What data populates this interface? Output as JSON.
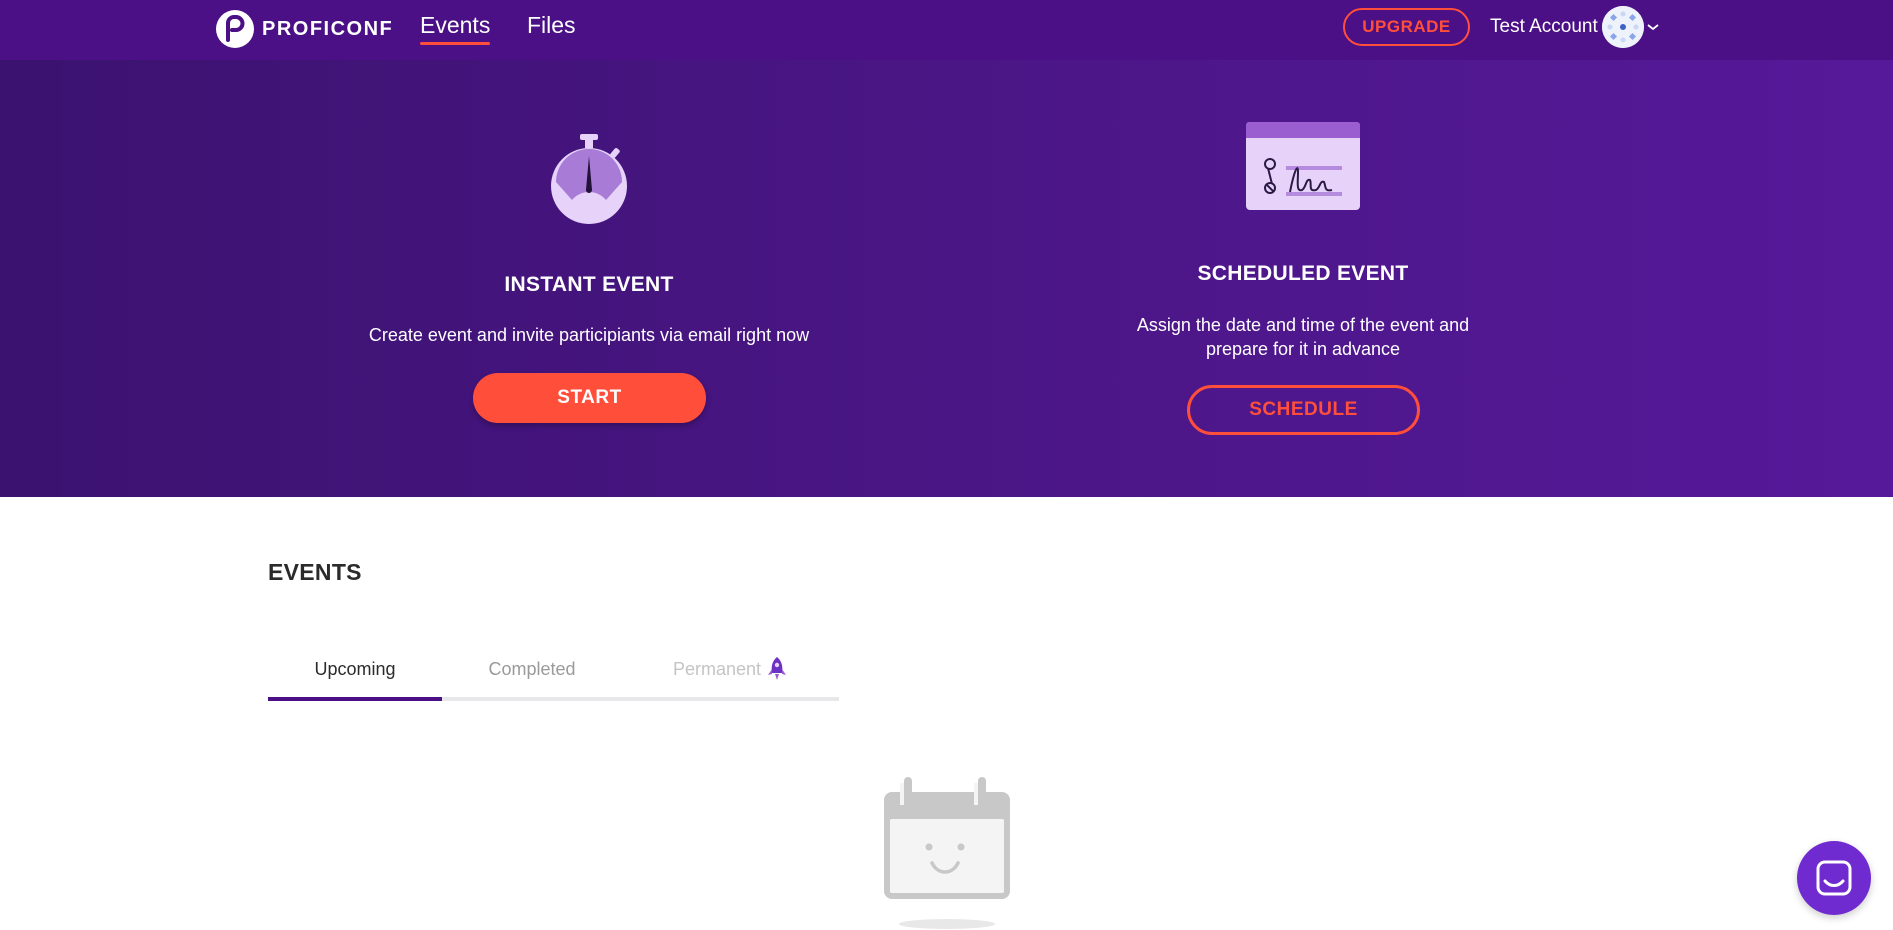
{
  "app": {
    "brand_name": "PROFICONF"
  },
  "nav": {
    "links": [
      {
        "label": "Events",
        "active": true
      },
      {
        "label": "Files",
        "active": false
      }
    ],
    "upgrade_label": "UPGRADE",
    "account_name": "Test Account"
  },
  "hero": {
    "instant": {
      "title": "INSTANT EVENT",
      "description": "Create event and invite participiants via email right now",
      "button_label": "START",
      "icon": "stopwatch-icon"
    },
    "scheduled": {
      "title": "SCHEDULED EVENT",
      "description_line1": "Assign the date and time of the event and",
      "description_line2": "prepare for it in advance",
      "button_label": "SCHEDULE",
      "icon": "signature-document-icon"
    }
  },
  "events": {
    "title": "EVENTS",
    "tabs": [
      {
        "label": "Upcoming",
        "active": true
      },
      {
        "label": "Completed",
        "active": false
      },
      {
        "label": "Permanent",
        "active": false,
        "icon": "rocket-icon"
      }
    ],
    "empty_state_icon": "smiling-calendar-icon"
  },
  "colors": {
    "nav_bg": "#4b0f86",
    "accent": "#ff4f3b",
    "hero_gradient_start": "#3b1270",
    "hero_gradient_end": "#56199a",
    "tab_active": "#4b0f86",
    "chat_button": "#6f2ad0"
  },
  "chat": {
    "icon": "chat-icon"
  }
}
